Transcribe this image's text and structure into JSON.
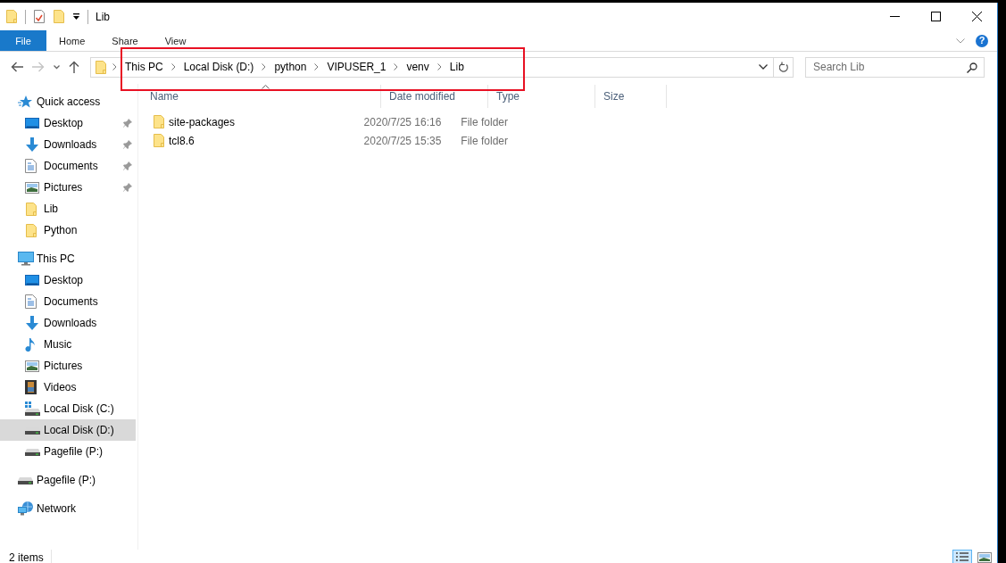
{
  "window": {
    "title": "Lib"
  },
  "ribbon": {
    "tabs": [
      {
        "label": "File",
        "kind": "file"
      },
      {
        "label": "Home",
        "kind": "tab"
      },
      {
        "label": "Share",
        "kind": "tab"
      },
      {
        "label": "View",
        "kind": "tab"
      }
    ],
    "help": "?"
  },
  "navigation": {
    "back": {
      "disabled": false
    },
    "forward": {
      "disabled": true
    }
  },
  "address": {
    "crumbs": [
      "This PC",
      "Local Disk (D:)",
      "python",
      "VIPUSER_1",
      "venv",
      "Lib"
    ]
  },
  "search": {
    "placeholder": "Search Lib"
  },
  "sidebar": {
    "items": [
      {
        "label": "Quick access",
        "kind": "star",
        "selected": false,
        "children": [
          {
            "label": "Desktop",
            "kind": "desktop",
            "pinned": true,
            "selected": false
          },
          {
            "label": "Downloads",
            "kind": "download",
            "pinned": true,
            "selected": false
          },
          {
            "label": "Documents",
            "kind": "document",
            "pinned": true,
            "selected": false
          },
          {
            "label": "Pictures",
            "kind": "picture",
            "pinned": true,
            "selected": false
          },
          {
            "label": "Lib",
            "kind": "folder",
            "pinned": false,
            "selected": false
          },
          {
            "label": "Python",
            "kind": "folder",
            "pinned": false,
            "selected": false
          }
        ]
      },
      {
        "label": "This PC",
        "kind": "pc",
        "selected": false,
        "children": [
          {
            "label": "Desktop",
            "kind": "desktop",
            "selected": false
          },
          {
            "label": "Documents",
            "kind": "document",
            "selected": false
          },
          {
            "label": "Downloads",
            "kind": "download",
            "selected": false
          },
          {
            "label": "Music",
            "kind": "music",
            "selected": false
          },
          {
            "label": "Pictures",
            "kind": "picture",
            "selected": false
          },
          {
            "label": "Videos",
            "kind": "video",
            "selected": false
          },
          {
            "label": "Local Disk (C:)",
            "kind": "system-disk",
            "selected": false
          },
          {
            "label": "Local Disk (D:)",
            "kind": "disk",
            "selected": true
          },
          {
            "label": "Pagefile (P:)",
            "kind": "disk",
            "selected": false
          }
        ]
      },
      {
        "label": "Pagefile (P:)",
        "kind": "disk",
        "selected": false
      },
      {
        "label": "Network",
        "kind": "network",
        "selected": false
      }
    ]
  },
  "table": {
    "columns": [
      {
        "label": "Name",
        "sorted": true
      },
      {
        "label": "Date modified",
        "sorted": false
      },
      {
        "label": "Type",
        "sorted": false
      },
      {
        "label": "Size",
        "sorted": false
      }
    ],
    "rows": [
      {
        "name": "site-packages",
        "date_modified": "2020/7/25 16:16",
        "type": "File folder",
        "selected": false
      },
      {
        "name": "tcl8.6",
        "date_modified": "2020/7/25 15:35",
        "type": "File folder",
        "selected": false
      }
    ]
  },
  "status_bar": {
    "text": "2 items",
    "views": [
      {
        "kind": "details",
        "selected": true
      },
      {
        "kind": "large-icons",
        "selected": false
      }
    ]
  },
  "annotations": [
    {
      "kind": "rectangle"
    }
  ]
}
